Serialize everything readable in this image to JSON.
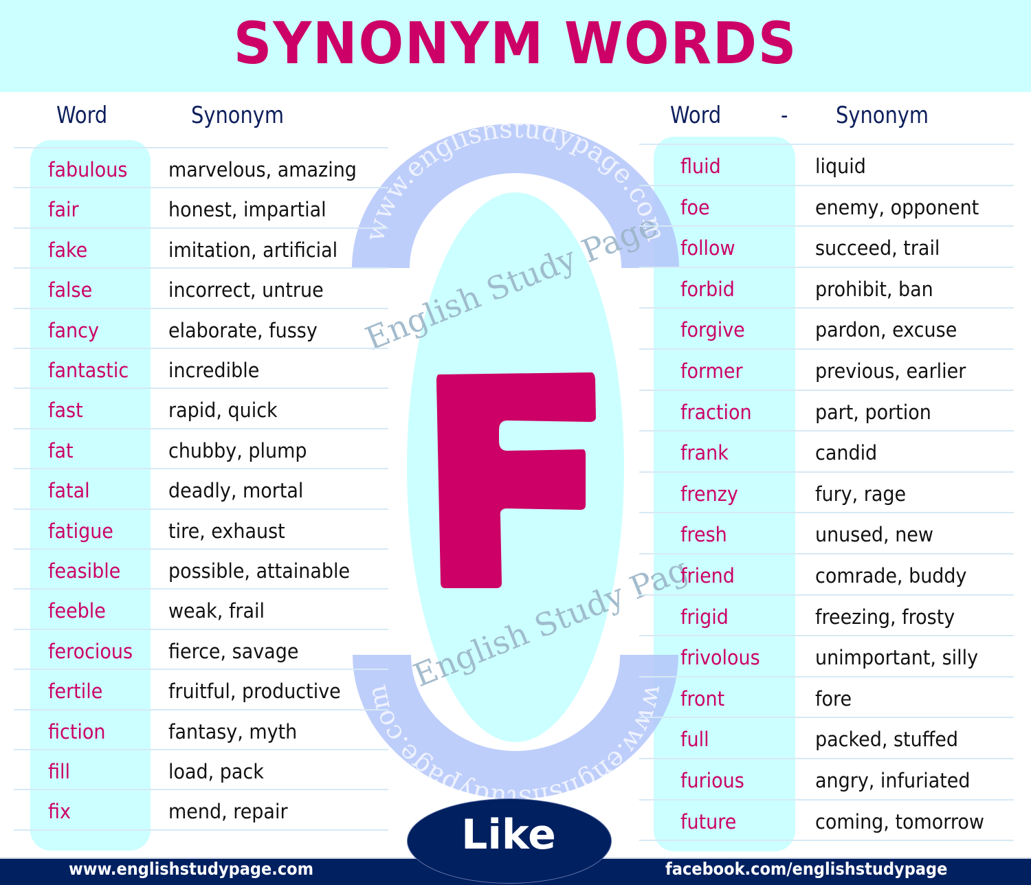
{
  "header": {
    "title": "SYNONYM WORDS"
  },
  "left_table": {
    "headers": {
      "word": "Word",
      "synonym": "Synonym"
    },
    "rows": [
      {
        "word": "fabulous",
        "synonym": "marvelous, amazing"
      },
      {
        "word": "fair",
        "synonym": "honest, impartial"
      },
      {
        "word": "fake",
        "synonym": "imitation, artificial"
      },
      {
        "word": "false",
        "synonym": "incorrect, untrue"
      },
      {
        "word": "fancy",
        "synonym": "elaborate, fussy"
      },
      {
        "word": "fantastic",
        "synonym": "incredible"
      },
      {
        "word": "fast",
        "synonym": "rapid, quick"
      },
      {
        "word": "fat",
        "synonym": "chubby, plump"
      },
      {
        "word": "fatal",
        "synonym": "deadly, mortal"
      },
      {
        "word": "fatigue",
        "synonym": "tire, exhaust"
      },
      {
        "word": "feasible",
        "synonym": "possible, attainable"
      },
      {
        "word": "feeble",
        "synonym": "weak, frail"
      },
      {
        "word": "ferocious",
        "synonym": "fierce, savage"
      },
      {
        "word": "fertile",
        "synonym": "fruitful, productive"
      },
      {
        "word": "fiction",
        "synonym": "fantasy, myth"
      },
      {
        "word": "fill",
        "synonym": "load, pack"
      },
      {
        "word": "fix",
        "synonym": "mend, repair"
      }
    ]
  },
  "right_table": {
    "headers": {
      "word": "Word",
      "separator": "-",
      "synonym": "Synonym"
    },
    "rows": [
      {
        "word": "fluid",
        "synonym": "liquid"
      },
      {
        "word": "foe",
        "synonym": "enemy, opponent"
      },
      {
        "word": "follow",
        "synonym": "succeed, trail"
      },
      {
        "word": "forbid",
        "synonym": "prohibit, ban"
      },
      {
        "word": "forgive",
        "synonym": "pardon, excuse"
      },
      {
        "word": "former",
        "synonym": "previous, earlier"
      },
      {
        "word": "fraction",
        "synonym": "part, portion"
      },
      {
        "word": "frank",
        "synonym": "candid"
      },
      {
        "word": "frenzy",
        "synonym": "fury, rage"
      },
      {
        "word": "fresh",
        "synonym": "unused, new"
      },
      {
        "word": "friend",
        "synonym": "comrade, buddy"
      },
      {
        "word": "frigid",
        "synonym": "freezing, frosty"
      },
      {
        "word": "frivolous",
        "synonym": "unimportant, silly"
      },
      {
        "word": "front",
        "synonym": "fore"
      },
      {
        "word": "full",
        "synonym": "packed, stuffed"
      },
      {
        "word": "furious",
        "synonym": "angry, infuriated"
      },
      {
        "word": "future",
        "synonym": "coming, tomorrow"
      }
    ]
  },
  "center": {
    "letter": "F",
    "watermark_arc_top": "www.englishstudypage.com",
    "watermark_arc_bottom": "www.englishstudypage.com",
    "watermark_text_1": "English Study Page",
    "watermark_text_2": "English Study Page",
    "like_label": "Like"
  },
  "footer": {
    "website": "www.englishstudypage.com",
    "facebook": "facebook.com/englishstudypage"
  },
  "colors": {
    "accent_pink": "#cc0066",
    "header_bg": "#ccffff",
    "navy": "#002060",
    "heading_text": "#0d1f5c",
    "watermark_blue": "#b3c6fa"
  }
}
